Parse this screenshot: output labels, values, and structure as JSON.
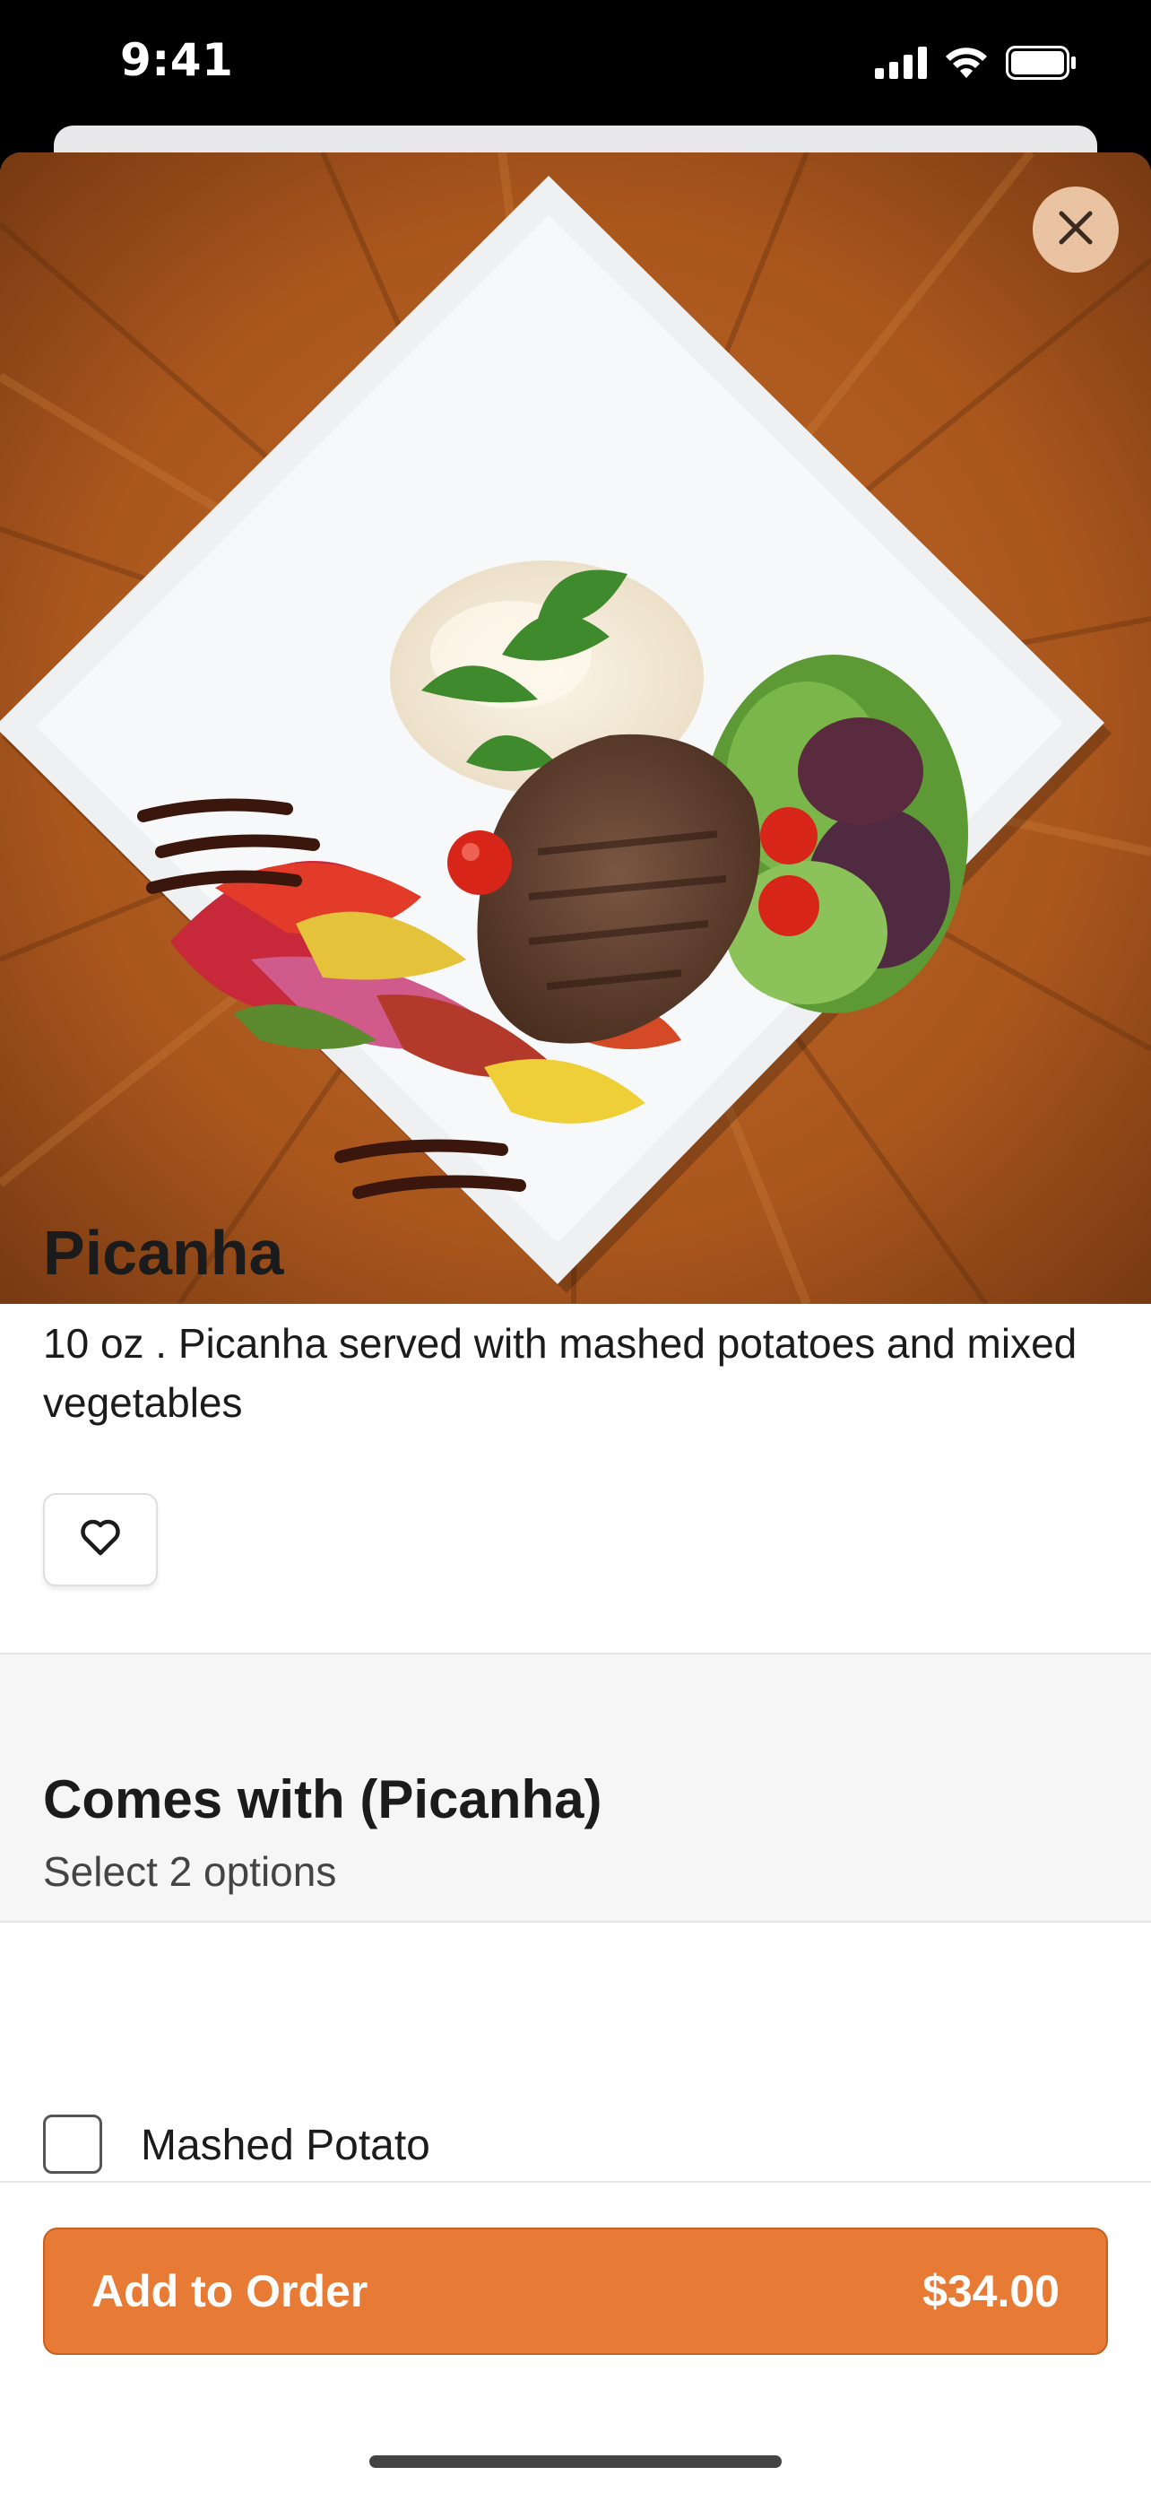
{
  "status_bar": {
    "time": "9:41",
    "icons": [
      "cellular-signal-icon",
      "wifi-icon",
      "battery-icon"
    ]
  },
  "hero": {
    "image": "grilled-steak-plate-photo",
    "close_icon": "close-icon"
  },
  "item": {
    "title": "Picanha",
    "description": "10 oz . Picanha served with mashed potatoes and mixed vegetables",
    "favorite_icon": "heart-icon"
  },
  "option_group": {
    "title": "Comes with (Picanha)",
    "subtitle": "Select 2 options",
    "options": [
      {
        "label": "Mashed Potato",
        "checked": false
      }
    ]
  },
  "footer": {
    "add_label": "Add to Order",
    "price": "$34.00"
  },
  "colors": {
    "accent": "#e77b36",
    "close_button_bg": "#e9c3a2"
  }
}
